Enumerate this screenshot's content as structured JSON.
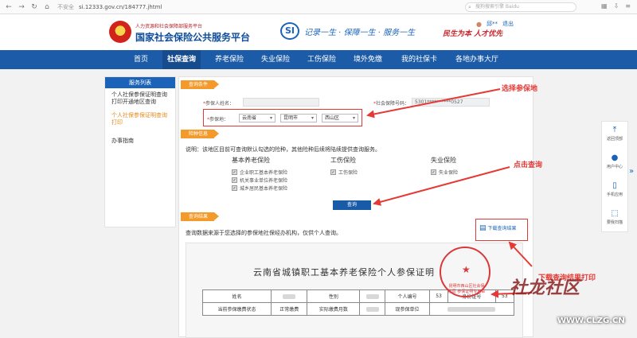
{
  "browser": {
    "insecure_label": "不安全",
    "url": "si.12333.gov.cn/184777.jhtml",
    "search_placeholder": "搜狗搜索引擎 Baidu"
  },
  "header": {
    "subtitle": "人力资源和社会保障部服务平台",
    "title": "国家社会保险公共服务平台",
    "logo_text": "SI",
    "slogan": "记录一生 · 保障一生 · 服务一生",
    "slogan2": "民生为本 人才优先",
    "user_name": "邱**",
    "logout": "退出"
  },
  "nav": {
    "items": [
      "首页",
      "社保查询",
      "养老保险",
      "失业保险",
      "工伤保险",
      "境外免缴",
      "我的社保卡",
      "各地办事大厅"
    ],
    "active_index": 1
  },
  "sidebar": {
    "title": "服务列表",
    "items": [
      "个人社保参保证明查询打印开通地区查询",
      "个人社保参保证明查询打印",
      "办事指南"
    ],
    "active_index": 1
  },
  "query": {
    "tag": "查询条件",
    "name_label": "参保人姓名：",
    "name_value": "",
    "ssn_label": "社会保障号码：",
    "ssn_value": "5301**********0527",
    "place_label": "参保地：",
    "province": "云南省",
    "city": "昆明市",
    "district": "西山区"
  },
  "insurance": {
    "tag": "险种信息",
    "notice": "说明：该地区目前可查询默认勾选的险种，其他险种后续将陆续提供查询服务。",
    "columns": [
      {
        "title": "基本养老保险",
        "items": [
          "企业职工基本养老保险",
          "机关事业单位养老保险",
          "城乡居民基本养老保险"
        ]
      },
      {
        "title": "工伤保险",
        "items": [
          "工伤保险"
        ]
      },
      {
        "title": "失业保险",
        "items": [
          "失业保险"
        ]
      }
    ],
    "query_button": "查询"
  },
  "result": {
    "tag": "查询结果",
    "note": "查询数据来源于您选择的参保地社保经办机构，仅供个人查询。",
    "download": "下载查询结果",
    "certificate_title": "云南省城镇职工基本养老保险个人参保证明",
    "seal_text": "昆明市西山区社会保险局 参保证明专用章",
    "table_rows": [
      [
        "姓名",
        "",
        "性别",
        "",
        "个人编号",
        "53",
        "身份证号",
        "53"
      ],
      [
        "当前参保缴费状态",
        "正常缴费",
        "实际缴费月数",
        "",
        "现参保单位",
        "",
        "",
        ""
      ]
    ]
  },
  "annotations": {
    "select_place": "选择参保地",
    "click_query": "点击查询",
    "download_print": "下载查询结果打印"
  },
  "float_toolbar": [
    "返回顶部",
    "用户中心",
    "手机应用",
    "要我扫描"
  ],
  "watermark": {
    "logo": "社龙社区",
    "url": "WWW.CLZG.CN"
  },
  "colors": {
    "nav_blue": "#1c5ba7",
    "accent_orange": "#f39a2b",
    "annotation_red": "#e53935"
  }
}
